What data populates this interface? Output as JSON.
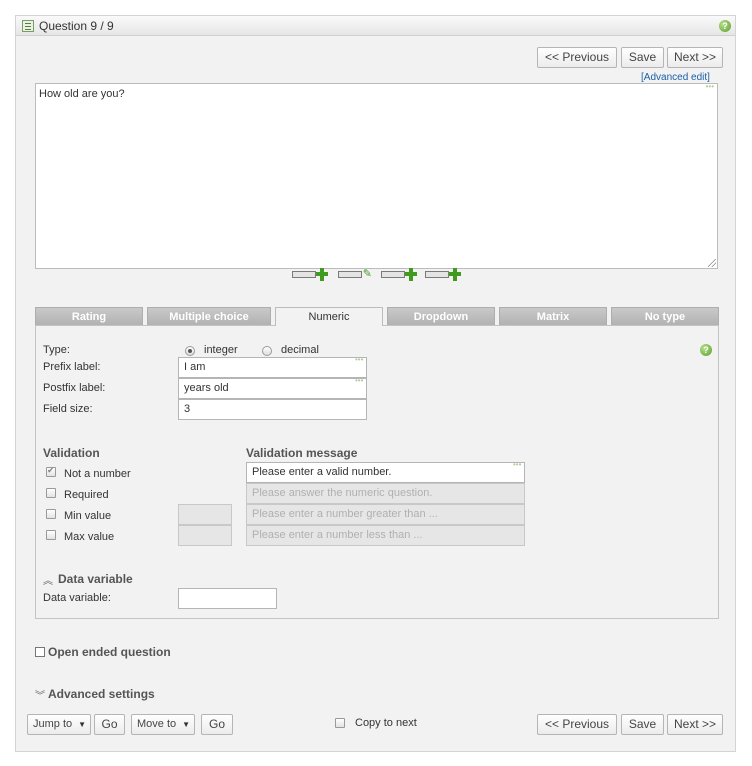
{
  "titlebar": {
    "title": "Question 9 / 9"
  },
  "nav_top": {
    "previous": "<< Previous",
    "save": "Save",
    "next": "Next >>"
  },
  "editor": {
    "advanced_edit": "[Advanced edit]",
    "text": "How old are you?"
  },
  "tabs": [
    {
      "label": "Rating",
      "active": false
    },
    {
      "label": "Multiple choice",
      "active": false
    },
    {
      "label": "Numeric",
      "active": true
    },
    {
      "label": "Dropdown",
      "active": false
    },
    {
      "label": "Matrix",
      "active": false
    },
    {
      "label": "No type",
      "active": false
    }
  ],
  "numeric": {
    "type_label": "Type:",
    "type_options": [
      {
        "label": "integer",
        "selected": true
      },
      {
        "label": "decimal",
        "selected": false
      }
    ],
    "prefix_label": "Prefix label:",
    "prefix_value": "I am",
    "postfix_label": "Postfix label:",
    "postfix_value": "years old",
    "field_size_label": "Field size:",
    "field_size_value": "3"
  },
  "validation": {
    "heading": "Validation",
    "message_heading": "Validation message",
    "rules": [
      {
        "label": "Not a number",
        "checked": true,
        "message": "Please enter a valid number.",
        "enabled": true
      },
      {
        "label": "Required",
        "checked": false,
        "message": "Please answer the numeric question.",
        "enabled": false
      },
      {
        "label": "Min value",
        "checked": false,
        "message": "Please enter a number greater than ...",
        "enabled": false
      },
      {
        "label": "Max value",
        "checked": false,
        "message": "Please enter a number less than ...",
        "enabled": false
      }
    ]
  },
  "data_variable": {
    "heading": "Data variable",
    "label": "Data variable:",
    "value": ""
  },
  "open_ended": {
    "label": "Open ended question"
  },
  "advanced_settings": {
    "label": "Advanced settings"
  },
  "footer": {
    "jump_to": "Jump to",
    "go1": "Go",
    "move_to": "Move to",
    "go2": "Go",
    "copy_to_next": "Copy to next",
    "previous": "<< Previous",
    "save": "Save",
    "next": "Next >>"
  },
  "colors": {
    "panel_bg": "#f2f2f2",
    "tab_inactive": "#b8b8b8",
    "link": "#1a5fa8",
    "help_green": "#5d9e2a"
  }
}
